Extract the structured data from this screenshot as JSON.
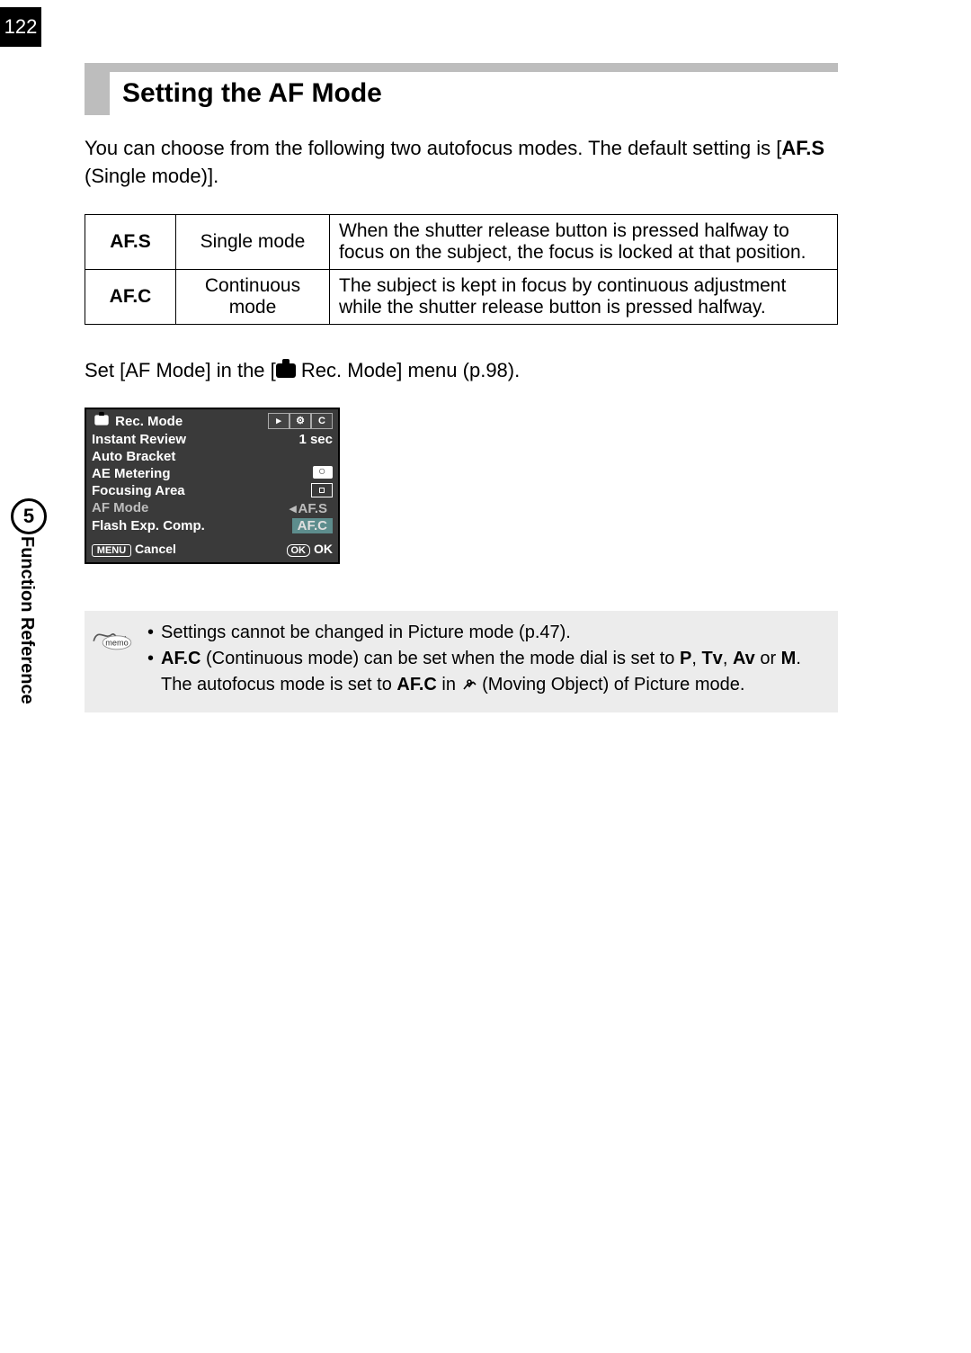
{
  "page_number": "122",
  "heading": "Setting the AF Mode",
  "lead_1": "You can choose from the following two autofocus modes. The default setting is [",
  "lead_bold": "AF.S",
  "lead_2": "  (Single mode)].",
  "table": {
    "r1_mode": "AF.S",
    "r1_name": "Single mode",
    "r1_desc": "When the shutter release button is pressed halfway to focus on the subject, the focus is locked at that position.",
    "r2_mode": "AF.C",
    "r2_name": "Continuous mode",
    "r2_desc": "The subject is kept in focus by continuous adjustment while the shutter release button is pressed halfway."
  },
  "set_line_pre": "Set [AF Mode] in the [",
  "set_line_post": " Rec. Mode] menu (p.98).",
  "lcd": {
    "title": "Rec. Mode",
    "tab1": "▸",
    "tab2": "⚙",
    "tab3": "C",
    "rows": {
      "instant_review": "Instant Review",
      "instant_review_val": "1 sec",
      "auto_bracket": "Auto Bracket",
      "ae_metering": "AE Metering",
      "focusing_area": "Focusing Area",
      "af_mode": "AF Mode",
      "af_mode_val": "AF.S",
      "flash": "Flash Exp. Comp.",
      "flash_val": "AF.C"
    },
    "menu_btn": "MENU",
    "cancel": "Cancel",
    "ok_btn": "OK",
    "ok": "OK"
  },
  "memo": {
    "b1": "Settings cannot be changed in Picture mode (p.47).",
    "b2_a": "AF.C",
    "b2_b": "  (Continuous mode) can be set when the mode dial is set to ",
    "b2_c": "P",
    "b2_d": ", ",
    "b2_e": "Tv",
    "b2_f": ", ",
    "b2_g": "Av",
    "b2_h": " or ",
    "b2_i": "M",
    "b2_j": ". The autofocus mode is set to ",
    "b2_k": "AF.C",
    "b2_l": " in ",
    "b2_m": " (Moving Object) of Picture mode."
  },
  "side_num": "5",
  "side_label": "Function Reference"
}
